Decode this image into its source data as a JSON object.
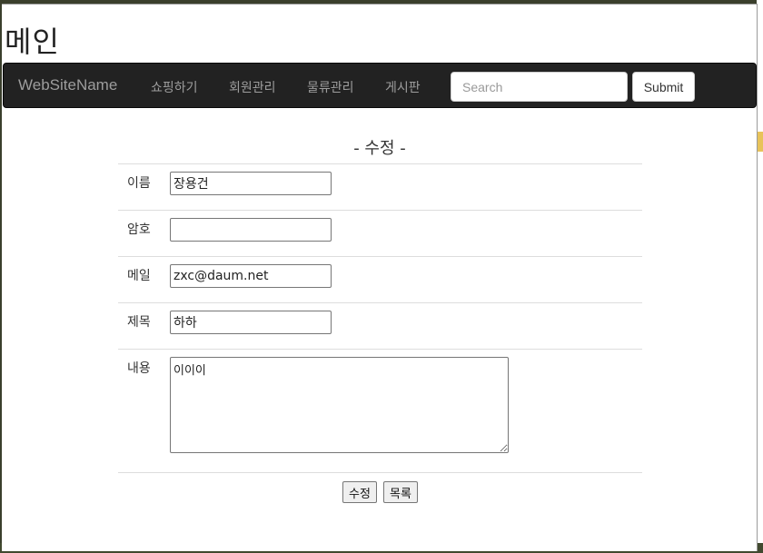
{
  "page": {
    "title": "메인"
  },
  "navbar": {
    "brand": "WebSiteName",
    "links": [
      "쇼핑하기",
      "회원관리",
      "물류관리",
      "게시판"
    ],
    "search_placeholder": "Search",
    "submit_label": "Submit"
  },
  "form": {
    "heading": "- 수정 -",
    "fields": {
      "name": {
        "label": "이름",
        "value": "장용건"
      },
      "password": {
        "label": "암호",
        "value": ""
      },
      "email": {
        "label": "메일",
        "value": "zxc@daum.net"
      },
      "subject": {
        "label": "제목",
        "value": "하하"
      },
      "content": {
        "label": "내용",
        "value": "이이이"
      }
    },
    "buttons": {
      "edit": "수정",
      "list": "목록"
    }
  }
}
